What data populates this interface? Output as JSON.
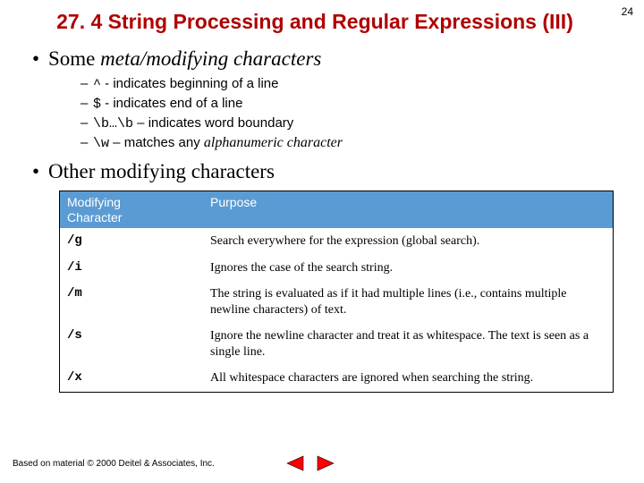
{
  "page_number": "24",
  "title": "27. 4 String Processing and Regular Expressions (III)",
  "section1": {
    "heading_prefix": "Some ",
    "heading_em": "meta/modifying characters",
    "items": [
      {
        "code": "^",
        "rest": " - indicates beginning of a line"
      },
      {
        "code": "$",
        "rest": " - indicates end of a line"
      },
      {
        "code": "\\b…\\b",
        "rest": " – indicates word boundary"
      },
      {
        "code": "\\w",
        "rest_prefix": " – matches any ",
        "rest_em": "alphanumeric character"
      }
    ]
  },
  "section2_heading": "Other modifying characters",
  "table": {
    "headers": {
      "c1a": "Modifying",
      "c1b": "Character",
      "c2": "Purpose"
    },
    "rows": [
      {
        "c1": "/g",
        "c2": "Search everywhere for the expression (global search)."
      },
      {
        "c1": "/i",
        "c2": "Ignores the case of the search string."
      },
      {
        "c1": "/m",
        "c2": "The string is evaluated as if it had multiple lines (i.e., contains multiple newline characters) of text."
      },
      {
        "c1": "/s",
        "c2": "Ignore the newline character and treat it as whitespace. The text is seen as a single line."
      },
      {
        "c1": "/x",
        "c2": "All whitespace characters are ignored when searching the string."
      }
    ]
  },
  "footer": "Based on material © 2000 Deitel & Associates, Inc."
}
